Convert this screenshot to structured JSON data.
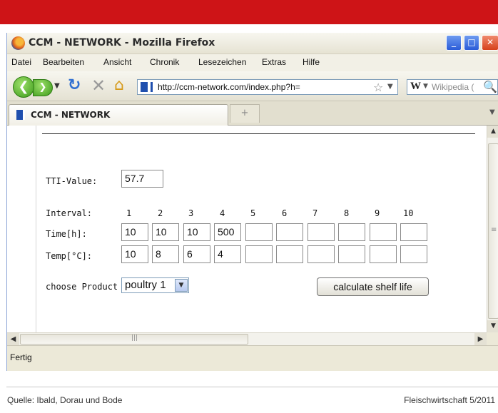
{
  "window": {
    "title": "CCM - NETWORK - Mozilla Firefox",
    "min_glyph": "_",
    "max_glyph": "□",
    "close_glyph": "✕"
  },
  "menu": {
    "items": [
      "Datei",
      "Bearbeiten",
      "Ansicht",
      "Chronik",
      "Lesezeichen",
      "Extras",
      "Hilfe"
    ]
  },
  "navigation": {
    "back_glyph": "❮",
    "forward_glyph": "❯",
    "dropdown_glyph": "▼",
    "reload_glyph": "↻",
    "stop_glyph": "✕",
    "home_glyph": "⌂",
    "url": "http://ccm-network.com/index.php?h=",
    "star_glyph": "☆",
    "search_engine_glyph": "W",
    "search_placeholder": "Wikipedia (",
    "search_glyph": "🔍"
  },
  "tabs": {
    "active_label": "CCM - NETWORK",
    "new_tab_glyph": "+",
    "list_glyph": "▼"
  },
  "form": {
    "tti_label": "TTI-Value:",
    "tti_value": "57.7",
    "interval_label": "Interval:",
    "interval_numbers": [
      "1",
      "2",
      "3",
      "4",
      "5",
      "6",
      "7",
      "8",
      "9",
      "10"
    ],
    "time_label": "Time[h]:",
    "time_values": [
      "10",
      "10",
      "10",
      "500",
      "",
      "",
      "",
      "",
      "",
      ""
    ],
    "temp_label": "Temp[°C]:",
    "temp_values": [
      "10",
      "8",
      "6",
      "4",
      "",
      "",
      "",
      "",
      "",
      ""
    ],
    "product_label": "choose Product",
    "product_value": "poultry 1",
    "calculate_button": "calculate shelf life"
  },
  "scrollbars": {
    "up_glyph": "▲",
    "down_glyph": "▼",
    "left_glyph": "◀",
    "right_glyph": "▶",
    "grip_glyph": "≡",
    "hgrip_glyph": "|||"
  },
  "status": {
    "text": "Fertig"
  },
  "caption": {
    "source": "Quelle: Ibald, Dorau und Bode",
    "publication": "Fleischwirtschaft 5/2011"
  },
  "colors": {
    "brand_red": "#ce1417",
    "nav_green": "#3b9a1a",
    "xp_blue": "#2a5bd7"
  }
}
